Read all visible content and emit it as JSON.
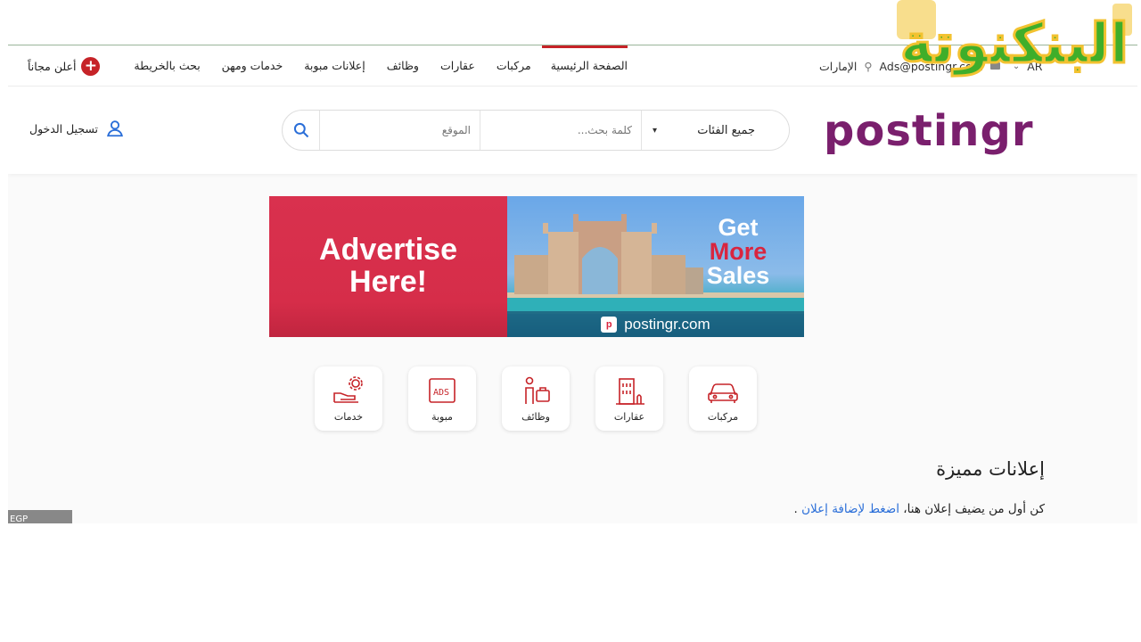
{
  "watermark": {
    "text": "البنكنوتة"
  },
  "topnav": {
    "links": [
      "الصفحة الرئيسية",
      "مركبات",
      "عقارات",
      "وظائف",
      "إعلانات مبوبة",
      "خدمات ومهن",
      "بحث بالخريطة"
    ],
    "post_free": "أعلن مجاناً",
    "country": "الإمارات",
    "email": "Ads@postingr.com",
    "language": "AR"
  },
  "header": {
    "login": "تسجيل الدخول",
    "search": {
      "location_placeholder": "الموقع",
      "keyword_placeholder": "كلمة بحث...",
      "category": "جميع الفئات"
    },
    "logo_text": "postingr"
  },
  "banner": {
    "left_line1": "Advertise",
    "left_line2": "Here!",
    "right_line1": "Get",
    "right_line2": "More",
    "right_line3": "Sales",
    "url": "postingr.com"
  },
  "categories": [
    {
      "label": "خدمات",
      "icon": "services-icon"
    },
    {
      "label": "مبوبة",
      "icon": "classifieds-icon"
    },
    {
      "label": "وظائف",
      "icon": "jobs-icon"
    },
    {
      "label": "عقارات",
      "icon": "building-icon"
    },
    {
      "label": "مركبات",
      "icon": "car-icon"
    }
  ],
  "featured": {
    "title": "إعلانات مميزة",
    "note_prefix": "كن أول من يضيف إعلان هنا،",
    "note_link": "اضغط لإضافة إعلان",
    "note_suffix": "."
  },
  "currency_badge": "EGP",
  "colors": {
    "brand_red": "#c62328",
    "brand_purple": "#7a1f6d",
    "link_blue": "#2a6ed8"
  }
}
